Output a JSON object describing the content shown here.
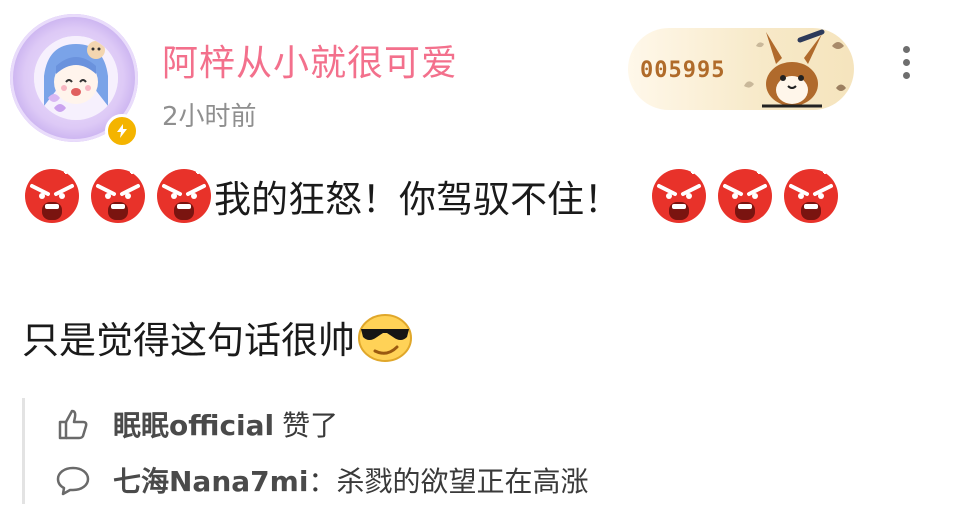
{
  "post": {
    "author": {
      "name": "阿梓从小就很可爱",
      "time": "2小时前",
      "fan_badge_number": "005995"
    },
    "content": {
      "line1_text": "我的狂怒！你驾驭不住！",
      "line2_text": "只是觉得这句话很帅"
    },
    "interactions": {
      "like": {
        "user": "眠眠official",
        "action": "赞了"
      },
      "comment": {
        "user": "七海Nana7mi",
        "separator": "：",
        "text": "杀戮的欲望正在高涨"
      }
    }
  },
  "icons": {
    "angry_emoji": "angry-face",
    "cool_emoji": "sunglasses-face",
    "like_icon": "thumbs-up",
    "comment_icon": "speech-bubble",
    "more_icon": "vertical-ellipsis",
    "badge_icon": "lightning"
  },
  "colors": {
    "username": "#f3708c",
    "timestamp": "#8f8f8f",
    "angry_red": "#e8322a",
    "badge": "#f4b400"
  }
}
